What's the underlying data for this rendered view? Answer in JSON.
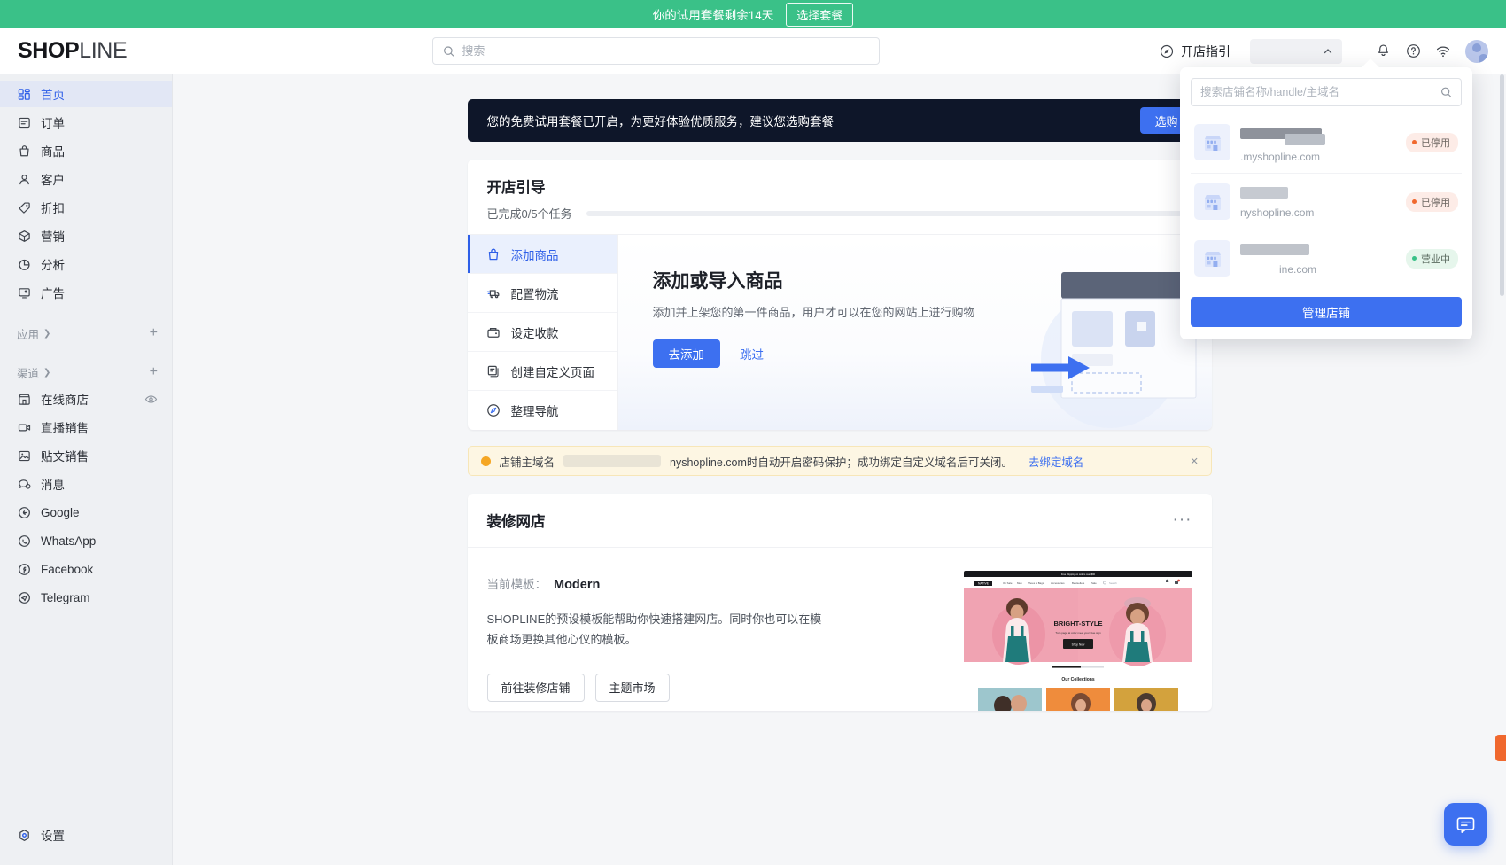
{
  "trial_banner": {
    "text": "你的试用套餐剩余14天",
    "cta": "选择套餐",
    "color": "#3ac188"
  },
  "header": {
    "logo_bold": "SHOP",
    "logo_thin": "LINE",
    "search_placeholder": "搜索",
    "guide_button": "开店指引",
    "icons": [
      "bell-icon",
      "help-icon",
      "wifi-icon",
      "avatar"
    ]
  },
  "sidebar": {
    "main_items": [
      {
        "label": "首页",
        "icon": "home-icon",
        "active": true
      },
      {
        "label": "订单",
        "icon": "order-icon",
        "active": false
      },
      {
        "label": "商品",
        "icon": "product-icon",
        "active": false
      },
      {
        "label": "客户",
        "icon": "customer-icon",
        "active": false
      },
      {
        "label": "折扣",
        "icon": "discount-icon",
        "active": false
      },
      {
        "label": "营销",
        "icon": "marketing-icon",
        "active": false
      },
      {
        "label": "分析",
        "icon": "analytics-icon",
        "active": false
      },
      {
        "label": "广告",
        "icon": "ads-icon",
        "active": false
      }
    ],
    "apps_section": {
      "label": "应用",
      "add": "+"
    },
    "channels_section": {
      "label": "渠道",
      "add": "+"
    },
    "channel_items": [
      {
        "label": "在线商店",
        "icon": "store-icon",
        "trailing": "eye-icon"
      },
      {
        "label": "直播销售",
        "icon": "video-icon",
        "trailing": ""
      },
      {
        "label": "贴文销售",
        "icon": "post-icon",
        "trailing": ""
      },
      {
        "label": "消息",
        "icon": "message-icon",
        "trailing": ""
      },
      {
        "label": "Google",
        "icon": "google-icon",
        "trailing": ""
      },
      {
        "label": "WhatsApp",
        "icon": "whatsapp-icon",
        "trailing": ""
      },
      {
        "label": "Facebook",
        "icon": "facebook-icon",
        "trailing": ""
      },
      {
        "label": "Telegram",
        "icon": "telegram-icon",
        "trailing": ""
      }
    ],
    "settings": {
      "label": "设置",
      "icon": "gear-icon"
    }
  },
  "dark_banner": {
    "text": "您的免费试用套餐已开启，为更好体验优质服务，建议您选购套餐",
    "button": "选购"
  },
  "guide_card": {
    "title": "开店引导",
    "progress_text": "已完成0/5个任务",
    "progress_percent": 0,
    "tasks": [
      {
        "label": "添加商品",
        "icon": "bag-icon",
        "active": true
      },
      {
        "label": "配置物流",
        "icon": "truck-icon",
        "active": false
      },
      {
        "label": "设定收款",
        "icon": "wallet-icon",
        "active": false
      },
      {
        "label": "创建自定义页面",
        "icon": "page-icon",
        "active": false
      },
      {
        "label": "整理导航",
        "icon": "compass-icon",
        "active": false
      }
    ],
    "detail": {
      "title": "添加或导入商品",
      "subtitle": "添加并上架您的第一件商品，用户才可以在您的网站上进行购物",
      "primary_button": "去添加",
      "skip_link": "跳过"
    }
  },
  "domain_alert": {
    "label": "店铺主域名",
    "text": "nyshopline.com时自动开启密码保护；成功绑定自定义域名后可关闭。",
    "link": "去绑定域名",
    "close": "×"
  },
  "theme_card": {
    "title": "装修网店",
    "menu": "···",
    "template_label": "当前模板：",
    "template_name": "Modern",
    "description": "SHOPLINE的预设模板能帮助你快速搭建网店。同时你也可以在模板商场更换其他心仪的模板。",
    "buttons": [
      "前往装修店铺",
      "主题市场"
    ],
    "preview": {
      "brand": "NATIVE",
      "nav": [
        "On Sale",
        "Men",
        "Shoes & Bags",
        "Accessories",
        "Bestsellers",
        "Sale"
      ],
      "hero_title": "BRIGHT-STYLE",
      "hero_sub": "Turn page at color meet your blue sign",
      "hero_button": "Shop Now",
      "collections_title": "Our Collections"
    }
  },
  "store_dropdown": {
    "search_placeholder": "搜索店铺名称/handle/主域名",
    "stores": [
      {
        "domain": ".myshopline.com",
        "status": "已停用",
        "state": "off",
        "name_width": 92
      },
      {
        "domain": "nyshopline.com",
        "status": "已停用",
        "state": "off",
        "name_width": 54
      },
      {
        "domain": "ine.com",
        "status": "营业中",
        "state": "on",
        "name_width": 78
      }
    ],
    "manage_button": "管理店铺"
  },
  "chat_fab": {
    "icon": "chat-icon"
  },
  "colors": {
    "accent_blue": "#3d70f0",
    "brand_green": "#3ac188",
    "warning": "#f5a623",
    "danger": "#f0682e",
    "dark_banner": "#0e1629"
  }
}
